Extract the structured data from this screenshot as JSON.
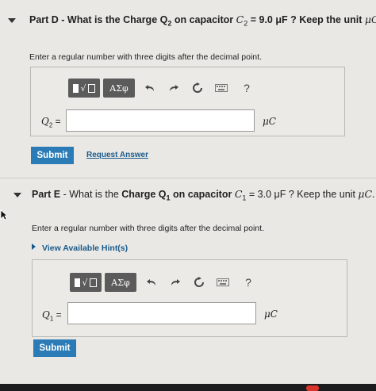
{
  "part_d": {
    "label": "Part D",
    "question": " - What is the Charge ",
    "charge_main": "Q",
    "charge_sub": "2",
    "on_capacitor": " on capacitor ",
    "cap_var": "C",
    "cap_sub": "2",
    "cap_value": " = 9.0 μF",
    "keep_unit": " ? Keep the unit ",
    "unit_text": "μC.",
    "instruction": "Enter a regular number with three digits after the decimal point.",
    "toolbar": {
      "greek": "ΑΣφ",
      "help": "?"
    },
    "variable_label": "Q",
    "variable_sub": "2",
    "variable_eq": " =",
    "input_value": "",
    "unit": "μC",
    "submit": "Submit",
    "request": "Request Answer"
  },
  "part_e": {
    "label": "Part E",
    "question": " - What is the ",
    "charge_main": "Charge Q",
    "charge_sub": "1",
    "on_capacitor": " on capacitor ",
    "cap_var": "C",
    "cap_sub": "1",
    "cap_value": " = 3.0 μF",
    "keep_unit": " ? Keep the unit ",
    "unit_text": "μC.",
    "instruction": "Enter a regular number with three digits after the decimal point.",
    "hint": "View Available Hint(s)",
    "toolbar": {
      "greek": "ΑΣφ",
      "help": "?"
    },
    "variable_label": "Q",
    "variable_sub": "1",
    "variable_eq": " =",
    "input_value": "",
    "unit": "μC",
    "submit": "Submit"
  },
  "colors": {
    "accent": "#2a7bb6",
    "link": "#1a5a8c",
    "toolbar": "#5b5b5b"
  }
}
